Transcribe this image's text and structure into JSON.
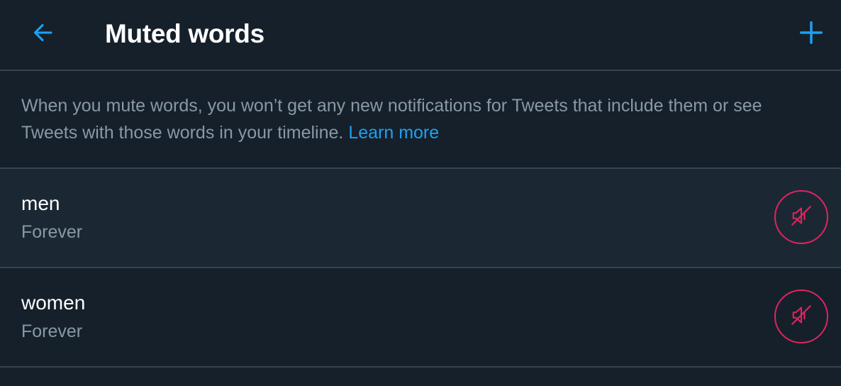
{
  "header": {
    "title": "Muted words",
    "back_icon": "arrow-left-icon",
    "add_icon": "plus-icon"
  },
  "description": {
    "text": "When you mute words, you won’t get any new notifications for Tweets that include them or see Tweets with those words in your timeline.",
    "link_label": "Learn more"
  },
  "muted_words": [
    {
      "word": "men",
      "duration": "Forever",
      "action_icon": "unmute-icon"
    },
    {
      "word": "women",
      "duration": "Forever",
      "action_icon": "unmute-icon"
    }
  ],
  "colors": {
    "background": "#15202b",
    "row_hover": "#1b2834",
    "divider": "#38444d",
    "accent": "#1da1f2",
    "secondary_text": "#8899a6",
    "danger": "#e0245e"
  }
}
